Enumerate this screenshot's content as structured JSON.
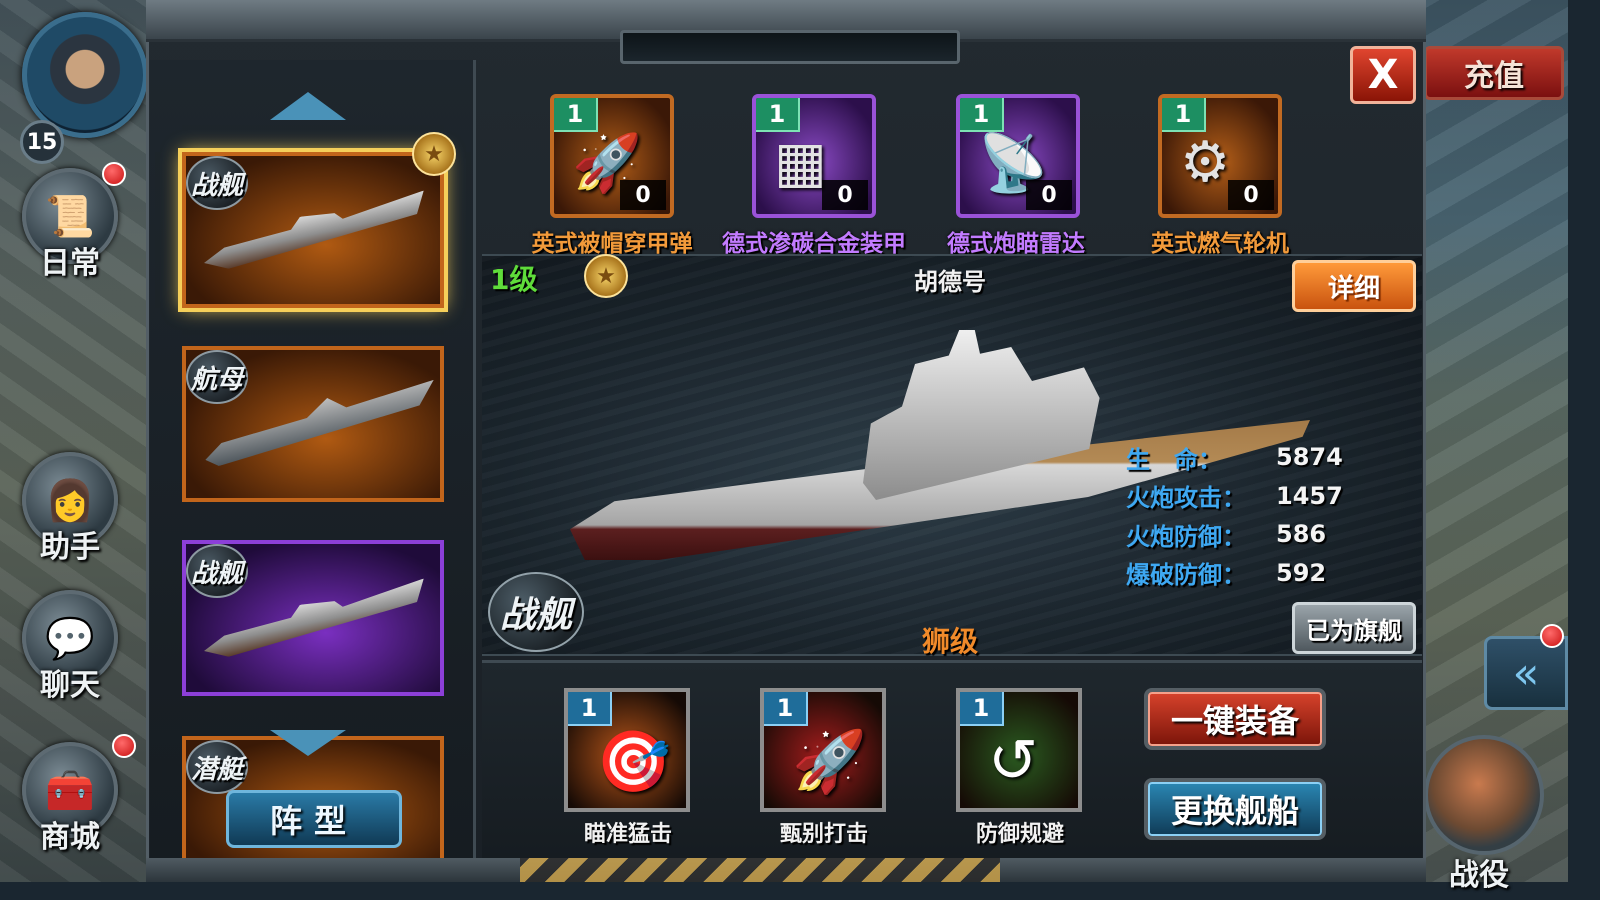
{
  "hud": {
    "player_level": "15",
    "left_menu": [
      {
        "label": "日常",
        "icon": "scroll-icon",
        "glyph": "📜"
      },
      {
        "label": "助手",
        "icon": "assistant-portrait-icon",
        "glyph": "👩"
      },
      {
        "label": "聊天",
        "icon": "chat-bubble-icon",
        "glyph": "💬"
      },
      {
        "label": "商城",
        "icon": "treasure-chest-icon",
        "glyph": "🧰"
      }
    ],
    "recharge_label": "充值",
    "campaign_label": "战役",
    "back_glyph": "«"
  },
  "close_label": "X",
  "ship_list": {
    "cards": [
      {
        "type_label": "战舰",
        "rarity": "orange",
        "selected": true,
        "starred": true
      },
      {
        "type_label": "航母",
        "rarity": "orange",
        "selected": false,
        "starred": false
      },
      {
        "type_label": "战舰",
        "rarity": "purple",
        "selected": false,
        "starred": false
      },
      {
        "type_label": "潜艇",
        "rarity": "orange",
        "selected": false,
        "starred": false
      }
    ],
    "formation_label": "阵型"
  },
  "equipment": [
    {
      "name": "英式被帽穿甲弹",
      "level": "1",
      "count": "0",
      "rarity": "orange",
      "icon": "armor-piercing-shell-icon",
      "glyph": "🚀"
    },
    {
      "name": "德式渗碳合金装甲",
      "level": "1",
      "count": "0",
      "rarity": "purple",
      "icon": "armor-plate-icon",
      "glyph": "▦"
    },
    {
      "name": "德式炮瞄雷达",
      "level": "1",
      "count": "0",
      "rarity": "purple",
      "icon": "radar-icon",
      "glyph": "📡"
    },
    {
      "name": "英式燃气轮机",
      "level": "1",
      "count": "0",
      "rarity": "orange",
      "icon": "turbine-engine-icon",
      "glyph": "⚙"
    }
  ],
  "ship": {
    "level_label": "1级",
    "name": "胡德号",
    "class_label": "狮级",
    "type_label": "战舰",
    "detail_label": "详细",
    "flagship_label": "已为旗舰",
    "star_glyph": "★",
    "stats": [
      {
        "label": "生　命：",
        "value": "5874"
      },
      {
        "label": "火炮攻击：",
        "value": "1457"
      },
      {
        "label": "火炮防御：",
        "value": "586"
      },
      {
        "label": "爆破防御：",
        "value": "592"
      }
    ]
  },
  "skills": [
    {
      "name": "瞄准猛击",
      "level": "1",
      "icon": "aimed-strike-icon",
      "glyph": "🎯",
      "bg": "#b8561a"
    },
    {
      "name": "甄别打击",
      "level": "1",
      "icon": "missile-strike-icon",
      "glyph": "🚀",
      "bg": "#a51d1d"
    },
    {
      "name": "防御规避",
      "level": "1",
      "icon": "evasion-icon",
      "glyph": "↺",
      "bg": "#2a5a20"
    }
  ],
  "actions": {
    "auto_equip_label": "一键装备",
    "change_ship_label": "更换舰船"
  }
}
